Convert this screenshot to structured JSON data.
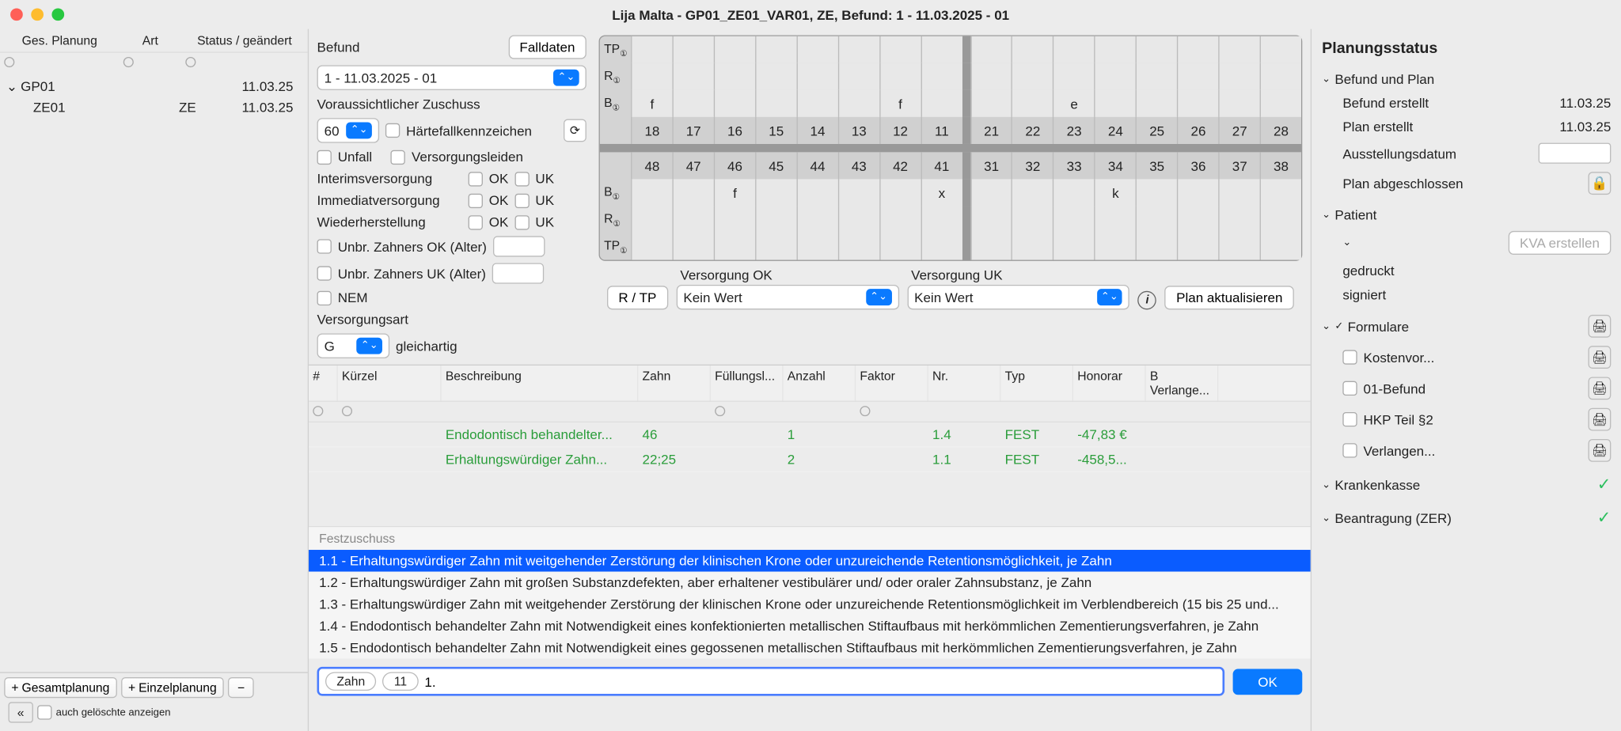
{
  "window": {
    "title": "Lija Malta  -  GP01_ZE01_VAR01, ZE, Befund: 1 - 11.03.2025 - 01"
  },
  "left": {
    "cols": [
      "Ges. Planung",
      "Art",
      "Status / geändert"
    ],
    "rows": [
      {
        "caret": "⌄",
        "name": "GP01",
        "art": "",
        "date": "11.03.25",
        "indent": 0
      },
      {
        "caret": "",
        "name": "ZE01",
        "art": "ZE",
        "date": "11.03.25",
        "indent": 1
      }
    ],
    "gesamt_btn": "Gesamtplanung",
    "einzel_btn": "Einzelplanung",
    "deleted_label": "auch gelöschte anzeigen"
  },
  "befund": {
    "label": "Befund",
    "falldaten": "Falldaten",
    "select": "1 - 11.03.2025 - 01",
    "zuschuss_label": "Voraussichtlicher Zuschuss",
    "zuschuss_val": "60",
    "haertefall": "Härtefallkennzeichen",
    "unfall": "Unfall",
    "versorgungsleiden": "Versorgungsleiden",
    "interim": "Interimsversorgung",
    "immediat": "Immediatversorgung",
    "wieder": "Wiederherstellung",
    "ok": "OK",
    "uk": "UK",
    "unbr_ok": "Unbr. Zahners OK (Alter)",
    "unbr_uk": "Unbr. Zahners UK (Alter)",
    "nem": "NEM",
    "versorgungsart_label": "Versorgungsart",
    "versorgungsart_val": "G",
    "versorgungsart_text": "gleichartig"
  },
  "tooth": {
    "row_labels": [
      "TP",
      "R",
      "B",
      "",
      "",
      "B",
      "R",
      "TP"
    ],
    "upper": [
      "18",
      "17",
      "16",
      "15",
      "14",
      "13",
      "12",
      "11",
      "21",
      "22",
      "23",
      "24",
      "25",
      "26",
      "27",
      "28"
    ],
    "lower": [
      "48",
      "47",
      "46",
      "45",
      "44",
      "43",
      "42",
      "41",
      "31",
      "32",
      "33",
      "34",
      "35",
      "36",
      "37",
      "38"
    ],
    "b_upper": {
      "18": "f",
      "12": "f",
      "23": "e"
    },
    "b_lower": {
      "46": "f",
      "41": "x",
      "34": "k"
    }
  },
  "versorgung": {
    "rtp": "R / TP",
    "ok_label": "Versorgung OK",
    "uk_label": "Versorgung UK",
    "ok_val": "Kein Wert",
    "uk_val": "Kein Wert",
    "plan_btn": "Plan aktualisieren"
  },
  "table": {
    "cols": [
      "#",
      "Kürzel",
      "Beschreibung",
      "Zahn",
      "Füllungsl...",
      "Anzahl",
      "Faktor",
      "Nr.",
      "Typ",
      "Honorar",
      "B Verlange..."
    ],
    "rows": [
      {
        "kuerzel": "",
        "besch": "Endodontisch behandelter...",
        "zahn": "46",
        "fuell": "",
        "anz": "1",
        "fakt": "",
        "nr": "1.4",
        "typ": "FEST",
        "hon": "-47,83 €",
        "bv": ""
      },
      {
        "kuerzel": "",
        "besch": "Erhaltungswürdiger Zahn...",
        "zahn": "22;25",
        "fuell": "",
        "anz": "2",
        "fakt": "",
        "nr": "1.1",
        "typ": "FEST",
        "hon": "-458,5...",
        "bv": ""
      }
    ]
  },
  "dropdown": {
    "header": "Festzuschuss",
    "items": [
      "1.1 - Erhaltungswürdiger Zahn mit weitgehender Zerstörung der klinischen Krone oder unzureichende Retentionsmöglichkeit, je Zahn",
      "1.2 - Erhaltungswürdiger Zahn mit großen Substanzdefekten, aber erhaltener vestibulärer und/ oder oraler Zahnsubstanz, je Zahn",
      "1.3 - Erhaltungswürdiger Zahn mit weitgehender Zerstörung der klinischen Krone oder unzureichende Retentionsmöglichkeit im Verblendbereich (15 bis 25 und...",
      "1.4 - Endodontisch behandelter Zahn mit Notwendigkeit eines konfektionierten metallischen Stiftaufbaus mit herkömmlichen Zementierungsverfahren, je Zahn",
      "1.5 - Endodontisch behandelter Zahn mit Notwendigkeit eines gegossenen metallischen Stiftaufbaus mit herkömmlichen Zementierungsverfahren, je Zahn"
    ]
  },
  "input": {
    "zahn_label": "Zahn",
    "zahn_val": "11",
    "text_val": "1.",
    "ok": "OK"
  },
  "right": {
    "title": "Planungsstatus",
    "sections": {
      "befund_plan": {
        "head": "Befund und Plan",
        "rows": [
          {
            "label": "Befund erstellt",
            "value": "11.03.25"
          },
          {
            "label": "Plan erstellt",
            "value": "11.03.25"
          },
          {
            "label": "Ausstellungsdatum",
            "input": true
          },
          {
            "label": "Plan abgeschlossen",
            "lock": true
          }
        ]
      },
      "patient": {
        "head": "Patient",
        "rows": [
          {
            "btn": "KVA erstellen",
            "disabled": true
          },
          {
            "label": "gedruckt"
          },
          {
            "label": "signiert"
          }
        ]
      },
      "formulare": {
        "head": "Formulare",
        "checked": true,
        "rows": [
          {
            "label": "Kostenvor...",
            "print": true
          },
          {
            "label": "01-Befund",
            "print": true
          },
          {
            "label": "HKP Teil §2",
            "print": true
          },
          {
            "label": "Verlangen...",
            "print": true
          }
        ]
      },
      "krankenkasse": {
        "head": "Krankenkasse",
        "check": true
      },
      "beantragung": {
        "head": "Beantragung (ZER)",
        "check": true
      }
    }
  }
}
